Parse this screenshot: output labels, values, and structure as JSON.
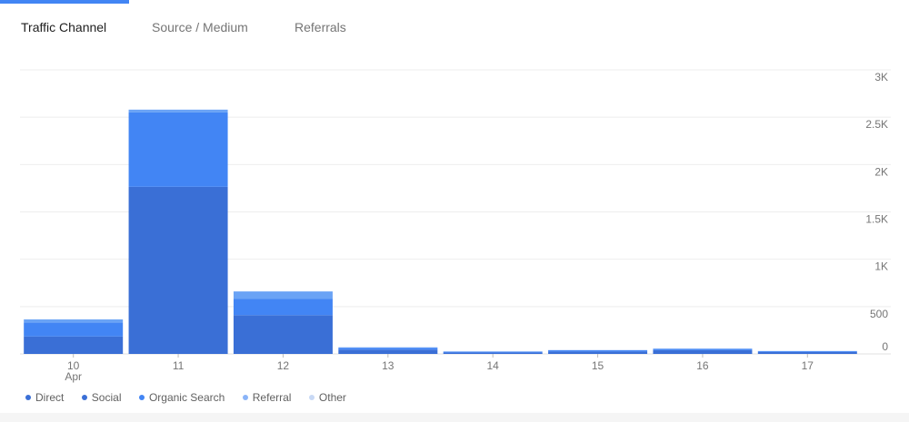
{
  "tabs": [
    {
      "label": "Traffic Channel",
      "active": true
    },
    {
      "label": "Source / Medium",
      "active": false
    },
    {
      "label": "Referrals",
      "active": false
    }
  ],
  "colors": {
    "Direct": "#3a6fd6",
    "Social": "#3a6fd6",
    "Organic Search": "#4285f4",
    "Referral": "#6aa3f5",
    "Other": "#c8d9f5",
    "grid": "#eeeeee",
    "axis_text": "#757575"
  },
  "chart_data": {
    "type": "bar",
    "stacked": true,
    "categories": [
      "10",
      "11",
      "12",
      "13",
      "14",
      "15",
      "16",
      "17"
    ],
    "x_sublabel": {
      "index": 0,
      "text": "Apr"
    },
    "y_ticks": [
      "0",
      "500",
      "1K",
      "1.5K",
      "2K",
      "2.5K",
      "3K"
    ],
    "y_tick_values": [
      0,
      500,
      1000,
      1500,
      2000,
      2500,
      3000
    ],
    "ylim": [
      0,
      3000
    ],
    "y_axis_side": "right",
    "grid": true,
    "legend_position": "bottom-left",
    "series": [
      {
        "name": "Direct",
        "values": [
          185,
          1765,
          410,
          45,
          15,
          25,
          40,
          20
        ]
      },
      {
        "name": "Social",
        "values": [
          0,
          0,
          0,
          0,
          0,
          0,
          0,
          0
        ]
      },
      {
        "name": "Organic Search",
        "values": [
          145,
          785,
          170,
          20,
          10,
          15,
          15,
          10
        ]
      },
      {
        "name": "Referral",
        "values": [
          35,
          30,
          80,
          5,
          0,
          0,
          0,
          0
        ]
      },
      {
        "name": "Other",
        "values": [
          0,
          0,
          0,
          0,
          0,
          0,
          0,
          0
        ]
      }
    ]
  }
}
